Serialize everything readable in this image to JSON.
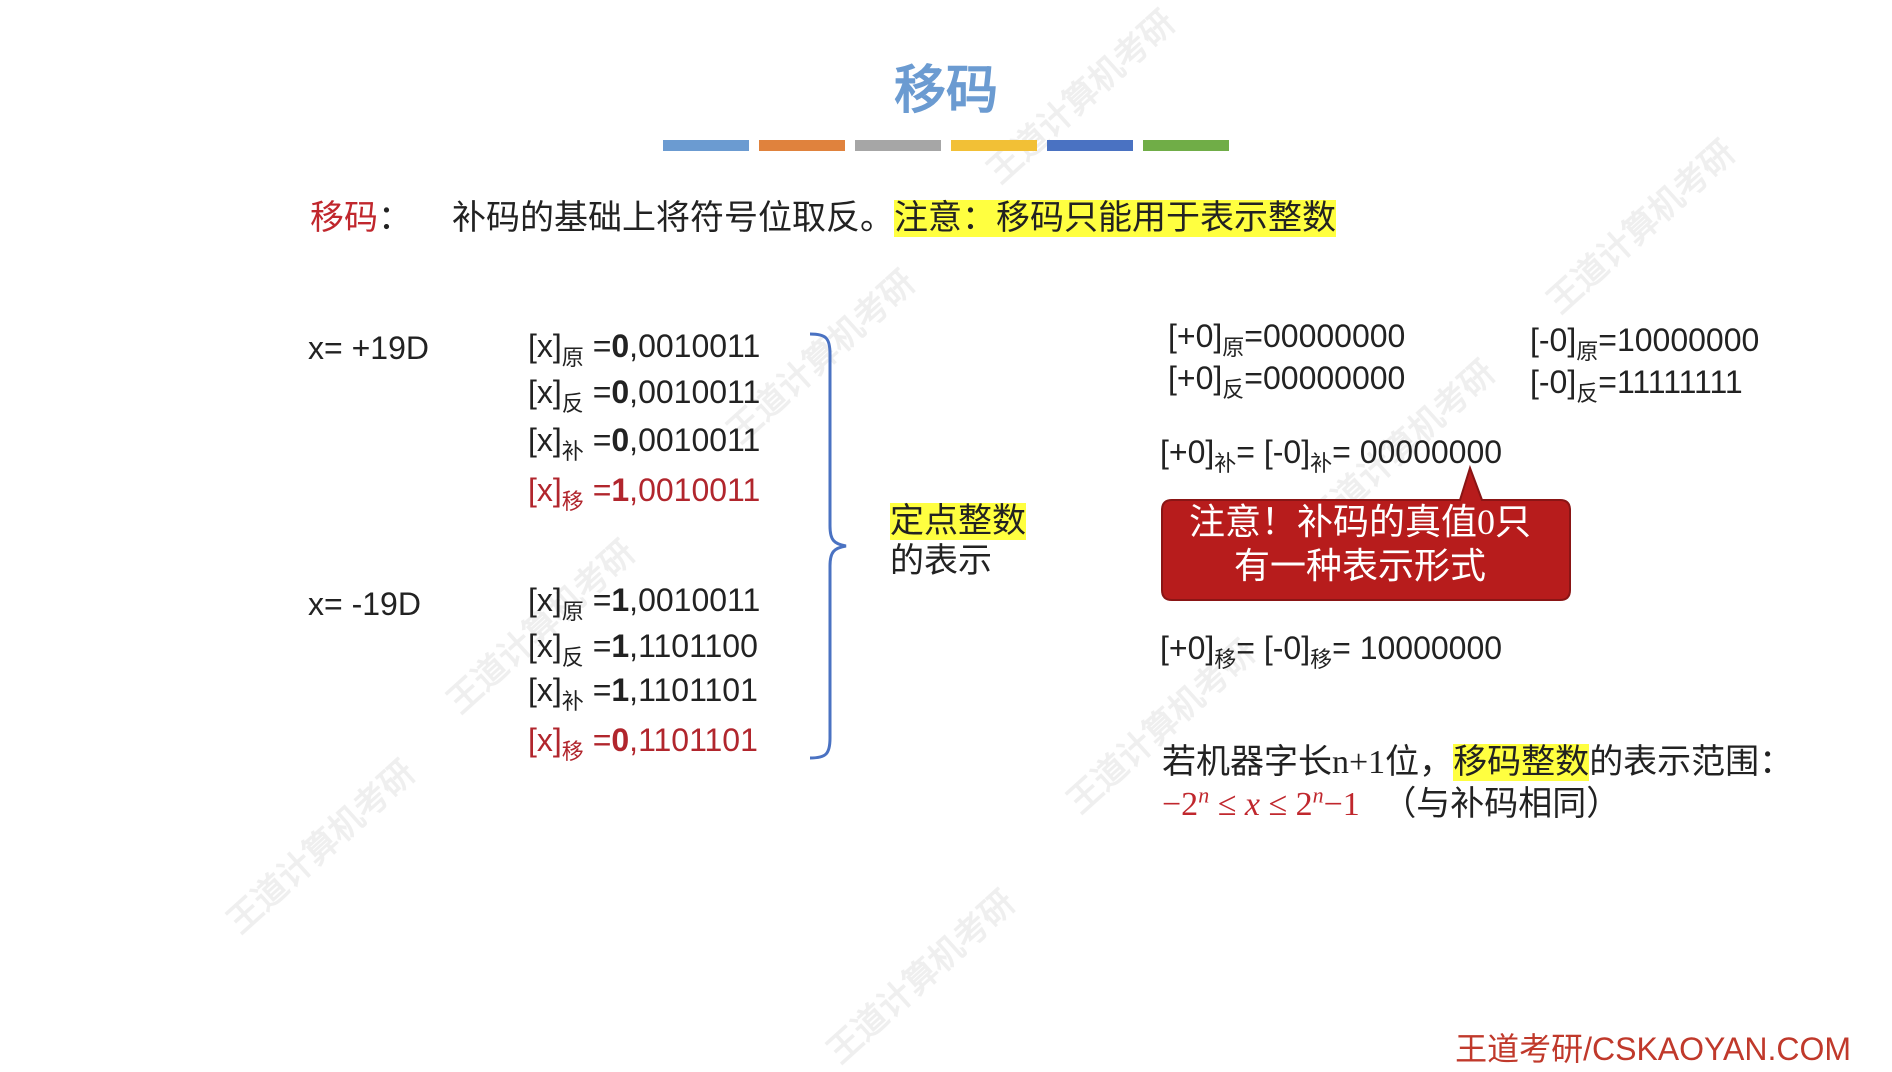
{
  "slide": {
    "title": "移码",
    "title_bar_colors": [
      "#6b9bd1",
      "#e0823d",
      "#a6a6a6",
      "#f2c036",
      "#4a72c2",
      "#70ad47"
    ],
    "definition": {
      "term": "移码",
      "term_sep": "：",
      "text": "补码的基础上将符号位取反。",
      "note": "注意：移码只能用于表示整数"
    },
    "left": {
      "pos": {
        "x_label": "x= +19D",
        "rows": [
          {
            "prefix": "[x]",
            "sub": "原",
            "eq": "=",
            "sign": "0",
            "rest": ",0010011"
          },
          {
            "prefix": "[x]",
            "sub": "反",
            "eq": "=",
            "sign": "0",
            "rest": ",0010011"
          },
          {
            "prefix": "[x]",
            "sub": "补",
            "eq": "=",
            "sign": "0",
            "rest": ",0010011"
          },
          {
            "prefix": "[x]",
            "sub": "移",
            "eq": "=",
            "sign": "1",
            "rest": ",0010011"
          }
        ]
      },
      "neg": {
        "x_label": "x= -19D",
        "rows": [
          {
            "prefix": "[x]",
            "sub": "原",
            "eq": "=",
            "sign": "1",
            "rest": ",0010011"
          },
          {
            "prefix": "[x]",
            "sub": "反",
            "eq": "=",
            "sign": "1",
            "rest": ",1101100"
          },
          {
            "prefix": "[x]",
            "sub": "补",
            "eq": "=",
            "sign": "1",
            "rest": ",1101101"
          },
          {
            "prefix": "[x]",
            "sub": "移",
            "eq": "=",
            "sign": "0",
            "rest": ",1101101"
          }
        ]
      },
      "brace_label_hl": "定点整数",
      "brace_label_rest": "的表示"
    },
    "right": {
      "plus0_yuan": {
        "a": "[+0]",
        "sub": "原",
        "b": "=00000000"
      },
      "plus0_fan": {
        "a": "[+0]",
        "sub": "反",
        "b": "=00000000"
      },
      "minus0_yuan": {
        "a": "[-0]",
        "sub": "原",
        "b": "=10000000"
      },
      "minus0_fan": {
        "a": "[-0]",
        "sub": "反",
        "b": "=11111111"
      },
      "bu_line": {
        "a": "[+0]",
        "sub1": "补",
        "b": "= [-0]",
        "sub2": "补",
        "c": "= 00000000"
      },
      "callout_line1": "注意！补码的真值0只",
      "callout_line2": "有一种表示形式",
      "yi_line": {
        "a": "[+0]",
        "sub1": "移",
        "b": "= [-0]",
        "sub2": "移",
        "c": "= 10000000"
      },
      "range_pre": "若机器字长n+1位，",
      "range_hl": "移码整数",
      "range_post": "的表示范围：",
      "formula": {
        "neg": "−2",
        "exp1": "n",
        "le1": " ≤ ",
        "x": "x",
        "le2": " ≤ ",
        "two": "2",
        "exp2": "n",
        "minus1": "−1",
        "note": "（与补码相同）"
      }
    },
    "watermark": "王道计算机考研",
    "footer": "王道考研/CSKAOYAN.COM"
  },
  "colors": {
    "title": "#6b9bd1",
    "red": "#c0272d",
    "highlight": "#ffff40",
    "callout_fill": "#b71c1c",
    "brace": "#4a72c2"
  }
}
